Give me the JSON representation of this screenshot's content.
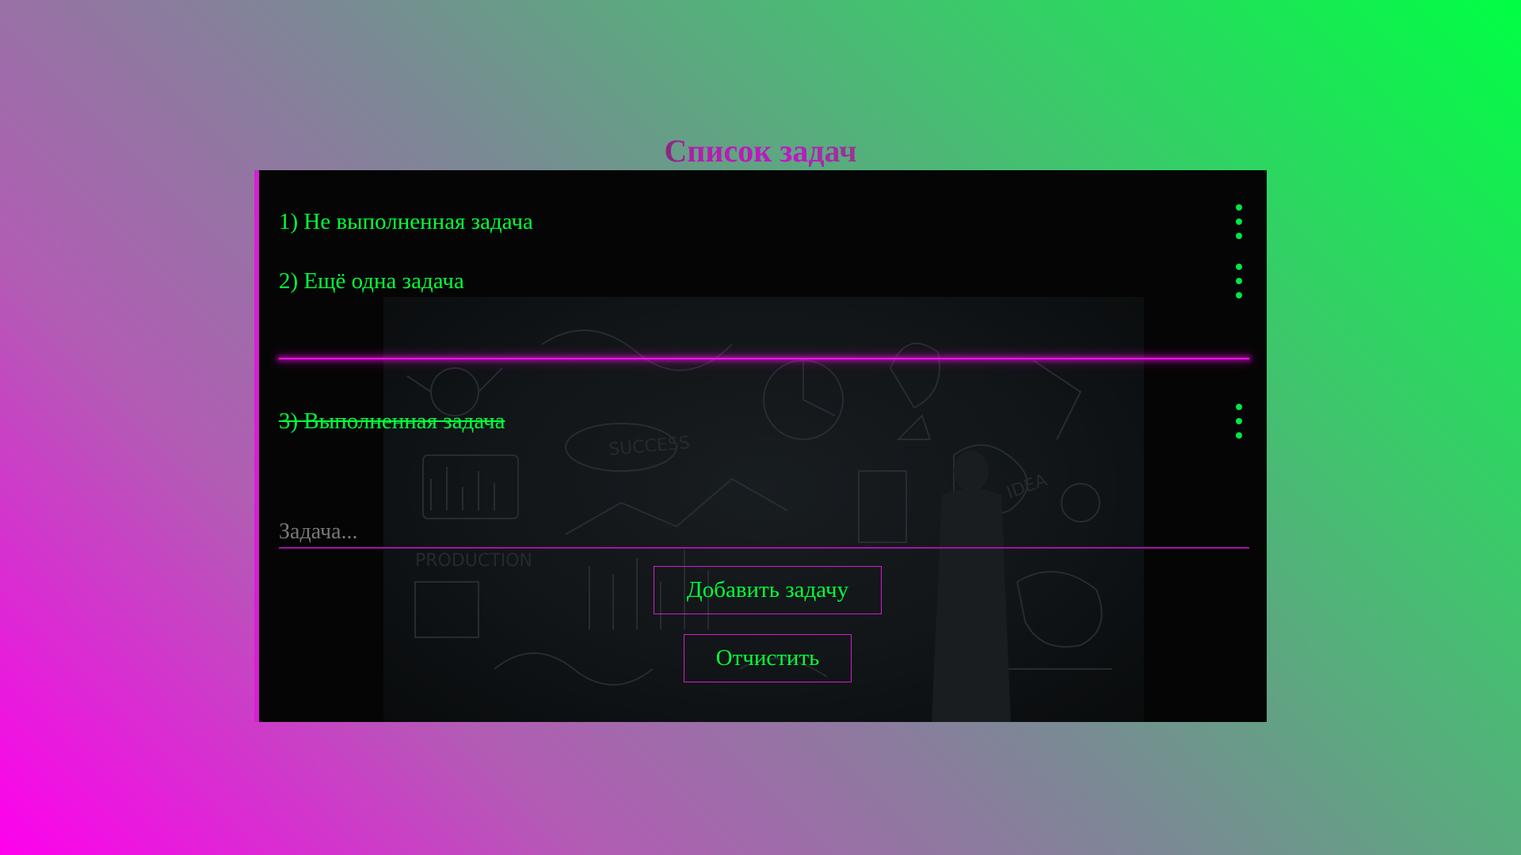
{
  "page": {
    "title": "Список задач"
  },
  "tasks": {
    "pending": [
      {
        "label": "1) Не выполненная задача"
      },
      {
        "label": "2) Ещё одна задача"
      }
    ],
    "completed": [
      {
        "label": "3) Выполненная задача"
      }
    ]
  },
  "form": {
    "input_value": "",
    "input_placeholder": "Задача...",
    "add_label": "Добавить задачу",
    "clear_label": "Отчистить"
  },
  "icons": {
    "menu": "more-vertical-icon"
  },
  "colors": {
    "accent_green": "#00ff3c",
    "accent_magenta": "#ff10f0",
    "panel_bg": "#050505"
  }
}
